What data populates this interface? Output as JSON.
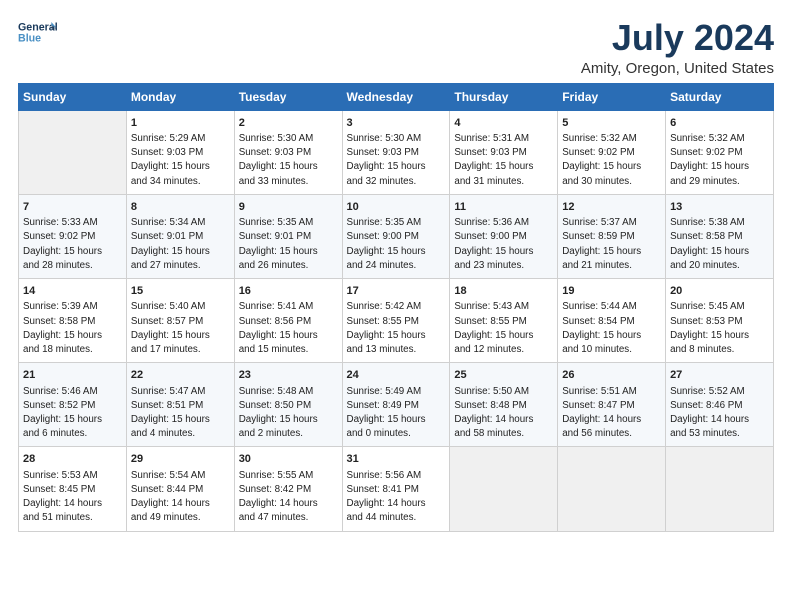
{
  "header": {
    "logo_line1": "General",
    "logo_line2": "Blue",
    "main_title": "July 2024",
    "subtitle": "Amity, Oregon, United States"
  },
  "calendar": {
    "days_of_week": [
      "Sunday",
      "Monday",
      "Tuesday",
      "Wednesday",
      "Thursday",
      "Friday",
      "Saturday"
    ],
    "weeks": [
      [
        {
          "day": "",
          "info": ""
        },
        {
          "day": "1",
          "info": "Sunrise: 5:29 AM\nSunset: 9:03 PM\nDaylight: 15 hours\nand 34 minutes."
        },
        {
          "day": "2",
          "info": "Sunrise: 5:30 AM\nSunset: 9:03 PM\nDaylight: 15 hours\nand 33 minutes."
        },
        {
          "day": "3",
          "info": "Sunrise: 5:30 AM\nSunset: 9:03 PM\nDaylight: 15 hours\nand 32 minutes."
        },
        {
          "day": "4",
          "info": "Sunrise: 5:31 AM\nSunset: 9:03 PM\nDaylight: 15 hours\nand 31 minutes."
        },
        {
          "day": "5",
          "info": "Sunrise: 5:32 AM\nSunset: 9:02 PM\nDaylight: 15 hours\nand 30 minutes."
        },
        {
          "day": "6",
          "info": "Sunrise: 5:32 AM\nSunset: 9:02 PM\nDaylight: 15 hours\nand 29 minutes."
        }
      ],
      [
        {
          "day": "7",
          "info": "Sunrise: 5:33 AM\nSunset: 9:02 PM\nDaylight: 15 hours\nand 28 minutes."
        },
        {
          "day": "8",
          "info": "Sunrise: 5:34 AM\nSunset: 9:01 PM\nDaylight: 15 hours\nand 27 minutes."
        },
        {
          "day": "9",
          "info": "Sunrise: 5:35 AM\nSunset: 9:01 PM\nDaylight: 15 hours\nand 26 minutes."
        },
        {
          "day": "10",
          "info": "Sunrise: 5:35 AM\nSunset: 9:00 PM\nDaylight: 15 hours\nand 24 minutes."
        },
        {
          "day": "11",
          "info": "Sunrise: 5:36 AM\nSunset: 9:00 PM\nDaylight: 15 hours\nand 23 minutes."
        },
        {
          "day": "12",
          "info": "Sunrise: 5:37 AM\nSunset: 8:59 PM\nDaylight: 15 hours\nand 21 minutes."
        },
        {
          "day": "13",
          "info": "Sunrise: 5:38 AM\nSunset: 8:58 PM\nDaylight: 15 hours\nand 20 minutes."
        }
      ],
      [
        {
          "day": "14",
          "info": "Sunrise: 5:39 AM\nSunset: 8:58 PM\nDaylight: 15 hours\nand 18 minutes."
        },
        {
          "day": "15",
          "info": "Sunrise: 5:40 AM\nSunset: 8:57 PM\nDaylight: 15 hours\nand 17 minutes."
        },
        {
          "day": "16",
          "info": "Sunrise: 5:41 AM\nSunset: 8:56 PM\nDaylight: 15 hours\nand 15 minutes."
        },
        {
          "day": "17",
          "info": "Sunrise: 5:42 AM\nSunset: 8:55 PM\nDaylight: 15 hours\nand 13 minutes."
        },
        {
          "day": "18",
          "info": "Sunrise: 5:43 AM\nSunset: 8:55 PM\nDaylight: 15 hours\nand 12 minutes."
        },
        {
          "day": "19",
          "info": "Sunrise: 5:44 AM\nSunset: 8:54 PM\nDaylight: 15 hours\nand 10 minutes."
        },
        {
          "day": "20",
          "info": "Sunrise: 5:45 AM\nSunset: 8:53 PM\nDaylight: 15 hours\nand 8 minutes."
        }
      ],
      [
        {
          "day": "21",
          "info": "Sunrise: 5:46 AM\nSunset: 8:52 PM\nDaylight: 15 hours\nand 6 minutes."
        },
        {
          "day": "22",
          "info": "Sunrise: 5:47 AM\nSunset: 8:51 PM\nDaylight: 15 hours\nand 4 minutes."
        },
        {
          "day": "23",
          "info": "Sunrise: 5:48 AM\nSunset: 8:50 PM\nDaylight: 15 hours\nand 2 minutes."
        },
        {
          "day": "24",
          "info": "Sunrise: 5:49 AM\nSunset: 8:49 PM\nDaylight: 15 hours\nand 0 minutes."
        },
        {
          "day": "25",
          "info": "Sunrise: 5:50 AM\nSunset: 8:48 PM\nDaylight: 14 hours\nand 58 minutes."
        },
        {
          "day": "26",
          "info": "Sunrise: 5:51 AM\nSunset: 8:47 PM\nDaylight: 14 hours\nand 56 minutes."
        },
        {
          "day": "27",
          "info": "Sunrise: 5:52 AM\nSunset: 8:46 PM\nDaylight: 14 hours\nand 53 minutes."
        }
      ],
      [
        {
          "day": "28",
          "info": "Sunrise: 5:53 AM\nSunset: 8:45 PM\nDaylight: 14 hours\nand 51 minutes."
        },
        {
          "day": "29",
          "info": "Sunrise: 5:54 AM\nSunset: 8:44 PM\nDaylight: 14 hours\nand 49 minutes."
        },
        {
          "day": "30",
          "info": "Sunrise: 5:55 AM\nSunset: 8:42 PM\nDaylight: 14 hours\nand 47 minutes."
        },
        {
          "day": "31",
          "info": "Sunrise: 5:56 AM\nSunset: 8:41 PM\nDaylight: 14 hours\nand 44 minutes."
        },
        {
          "day": "",
          "info": ""
        },
        {
          "day": "",
          "info": ""
        },
        {
          "day": "",
          "info": ""
        }
      ]
    ]
  }
}
